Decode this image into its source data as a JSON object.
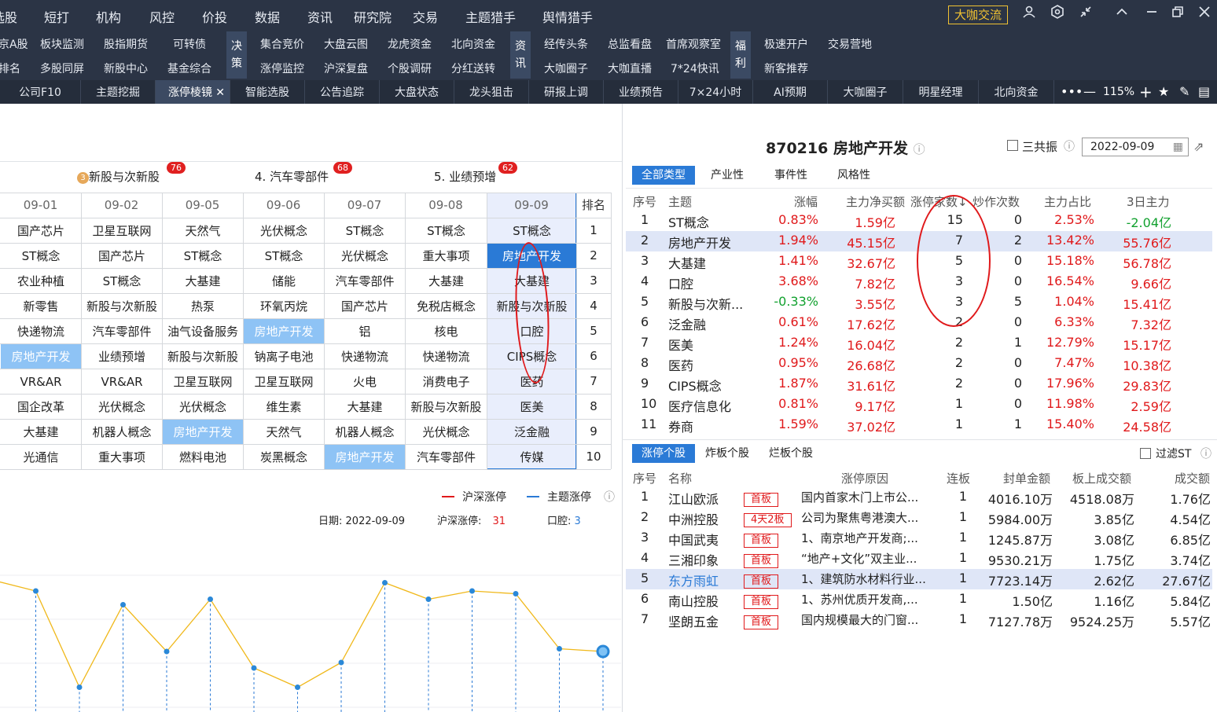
{
  "menu": [
    "选股",
    "短打",
    "机构",
    "风控",
    "价投",
    "数据",
    "资讯",
    "研究院",
    "交易",
    "主题猎手",
    "舆情猎手"
  ],
  "top_button": "大咖交流",
  "sub_left_r1": [
    "京A股",
    "板块监测",
    "股指期货",
    "可转债"
  ],
  "sub_left_r2": [
    "排名",
    "多股同屏",
    "新股中心",
    "基金综合"
  ],
  "group1": "决策",
  "sub_g1_r1": [
    "集合竞价",
    "大盘云图",
    "龙虎资金",
    "北向资金"
  ],
  "sub_g1_r2": [
    "涨停监控",
    "沪深复盘",
    "个股调研",
    "分红送转"
  ],
  "group2": "资讯",
  "sub_g2_r1": [
    "经传头条",
    "总监看盘",
    "首席观察室"
  ],
  "sub_g2_r2": [
    "大咖圈子",
    "大咖直播",
    "7*24快讯"
  ],
  "group3": "福利",
  "sub_g3_r1": [
    "极速开户",
    "交易营地"
  ],
  "sub_g3_r2": [
    "新客推荐"
  ],
  "tabs": [
    "公司F10",
    "主题挖掘",
    "涨停棱镜",
    "智能选股",
    "公告追踪",
    "大盘状态",
    "龙头狙击",
    "研报上调",
    "业绩预告",
    "7×24小时",
    "AI预期",
    "大咖圈子",
    "明星经理",
    "北向资金"
  ],
  "zoom": "115%",
  "categories": [
    {
      "label": "新股与次新股",
      "badge": "76",
      "rank": "3"
    },
    {
      "label": "4. 汽车零部件",
      "badge": "68"
    },
    {
      "label": "5. 业绩预增",
      "badge": "62"
    }
  ],
  "grid": {
    "dates": [
      "09-01",
      "09-02",
      "09-05",
      "09-06",
      "09-07",
      "09-08",
      "09-09"
    ],
    "rank_header": "排名",
    "ranks": [
      "1",
      "2",
      "3",
      "4",
      "5",
      "6",
      "7",
      "8",
      "9",
      "10"
    ],
    "rows": [
      [
        "国产芯片",
        "卫星互联网",
        "天然气",
        "光伏概念",
        "ST概念",
        "ST概念",
        "ST概念"
      ],
      [
        "ST概念",
        "国产芯片",
        "ST概念",
        "ST概念",
        "光伏概念",
        "重大事项",
        "房地产开发"
      ],
      [
        "农业种植",
        "ST概念",
        "大基建",
        "储能",
        "汽车零部件",
        "大基建",
        "大基建"
      ],
      [
        "新零售",
        "新股与次新股",
        "热泵",
        "环氧丙烷",
        "国产芯片",
        "免税店概念",
        "新股与次新股"
      ],
      [
        "快递物流",
        "汽车零部件",
        "油气设备服务",
        "房地产开发",
        "铝",
        "核电",
        "口腔"
      ],
      [
        "房地产开发",
        "业绩预增",
        "新股与次新股",
        "钠离子电池",
        "快递物流",
        "快递物流",
        "CIPS概念"
      ],
      [
        "VR&AR",
        "VR&AR",
        "卫星互联网",
        "卫星互联网",
        "火电",
        "消费电子",
        "医药"
      ],
      [
        "国企改革",
        "光伏概念",
        "光伏概念",
        "维生素",
        "大基建",
        "新股与次新股",
        "医美"
      ],
      [
        "大基建",
        "机器人概念",
        "房地产开发",
        "天然气",
        "机器人概念",
        "光伏概念",
        "泛金融"
      ],
      [
        "光通信",
        "重大事项",
        "燃料电池",
        "炭黑概念",
        "房地产开发",
        "汽车零部件",
        "传媒"
      ]
    ]
  },
  "legend": {
    "a": "沪深涨停",
    "b": "主题涨停"
  },
  "info": {
    "date_label": "日期:",
    "date": "2022-09-09",
    "hs_label": "沪深涨停:",
    "hs": "31",
    "theme_label": "口腔:",
    "theme": "3"
  },
  "line_chart": {
    "values": [
      88,
      84,
      49,
      79,
      62,
      81,
      56,
      49,
      58,
      87,
      81,
      84,
      83,
      63,
      62
    ],
    "ymin": 40,
    "ymax": 100
  },
  "stock": {
    "code": "870216",
    "name": "房地产开发",
    "sangongzhen": "三共振",
    "date": "2022-09-09"
  },
  "filter_tabs": [
    "全部类型",
    "产业性",
    "事件性",
    "风格性"
  ],
  "theme_table": {
    "headers": [
      "序号",
      "主题",
      "涨幅",
      "主力净买额",
      "涨停家数↓",
      "炒作次数",
      "主力占比",
      "3日主力"
    ],
    "rows": [
      [
        "1",
        "ST概念",
        "0.83%",
        "1.59亿",
        "15",
        "0",
        "2.53%",
        "-2.04亿"
      ],
      [
        "2",
        "房地产开发",
        "1.94%",
        "45.15亿",
        "7",
        "2",
        "13.42%",
        "55.76亿"
      ],
      [
        "3",
        "大基建",
        "1.41%",
        "32.67亿",
        "5",
        "0",
        "15.18%",
        "56.78亿"
      ],
      [
        "4",
        "口腔",
        "3.68%",
        "7.82亿",
        "3",
        "0",
        "16.54%",
        "9.66亿"
      ],
      [
        "5",
        "新股与次新...",
        "-0.33%",
        "3.55亿",
        "3",
        "5",
        "1.04%",
        "15.41亿"
      ],
      [
        "6",
        "泛金融",
        "0.61%",
        "17.62亿",
        "2",
        "0",
        "6.33%",
        "7.32亿"
      ],
      [
        "7",
        "医美",
        "1.24%",
        "16.04亿",
        "2",
        "1",
        "12.79%",
        "15.17亿"
      ],
      [
        "8",
        "医药",
        "0.95%",
        "26.68亿",
        "2",
        "0",
        "7.47%",
        "10.38亿"
      ],
      [
        "9",
        "CIPS概念",
        "1.87%",
        "31.61亿",
        "2",
        "0",
        "17.96%",
        "29.83亿"
      ],
      [
        "10",
        "医疗信息化",
        "0.81%",
        "9.17亿",
        "1",
        "0",
        "11.98%",
        "2.59亿"
      ],
      [
        "11",
        "券商",
        "1.59%",
        "37.02亿",
        "1",
        "1",
        "15.40%",
        "24.58亿"
      ]
    ]
  },
  "stock_tabs": [
    "涨停个股",
    "炸板个股",
    "烂板个股"
  ],
  "filter_st": "过滤ST",
  "stock_table": {
    "headers": [
      "序号",
      "名称",
      "涨停原因",
      "连板",
      "封单金额",
      "板上成交额",
      "成交额"
    ],
    "rows": [
      [
        "1",
        "江山欧派",
        "首板",
        "国内首家木门上市公...",
        "1",
        "4016.10万",
        "4518.08万",
        "1.76亿"
      ],
      [
        "2",
        "中洲控股",
        "4天2板",
        "公司为聚焦粤港澳大...",
        "1",
        "5984.00万",
        "3.85亿",
        "4.54亿"
      ],
      [
        "3",
        "中国武夷",
        "首板",
        "1、南京地产开发商;...",
        "1",
        "1245.87万",
        "3.08亿",
        "6.85亿"
      ],
      [
        "4",
        "三湘印象",
        "首板",
        "“地产+文化”双主业...",
        "1",
        "9530.21万",
        "1.75亿",
        "3.74亿"
      ],
      [
        "5",
        "东方雨虹",
        "首板",
        "1、建筑防水材料行业...",
        "1",
        "7723.14万",
        "2.62亿",
        "27.67亿"
      ],
      [
        "6",
        "南山控股",
        "首板",
        "1、苏州优质开发商,...",
        "1",
        "1.50亿",
        "1.16亿",
        "5.84亿"
      ],
      [
        "7",
        "坚朗五金",
        "首板",
        "国内规模最大的门窗...",
        "1",
        "7127.78万",
        "9524.25万",
        "5.57亿"
      ]
    ]
  },
  "colors": {
    "accent": "#2a7ad6",
    "up": "#e0191b",
    "down": "#12a12f",
    "highlight": "#8ec3f5",
    "header_bg": "#2b3445"
  }
}
